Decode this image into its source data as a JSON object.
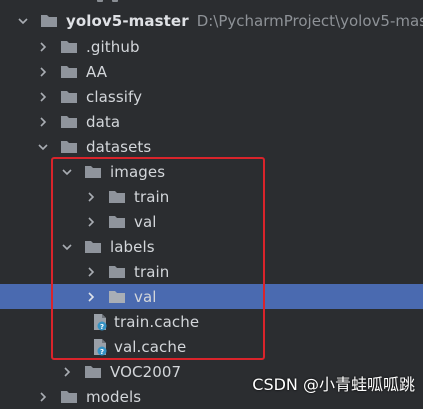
{
  "colors": {
    "background": "#2b2d30",
    "selection": "#4a6ab0",
    "highlight_box": "#d9242b",
    "folder": "#8f949c",
    "text": "#d3d6da",
    "path": "#8e9297",
    "file_badge": "#3592c4"
  },
  "tree": {
    "root": {
      "label": "yolov5-master",
      "path": "D:\\PycharmProject\\yolov5-master",
      "expanded": true
    },
    "items": [
      {
        "label": ".github",
        "type": "folder",
        "expanded": false
      },
      {
        "label": "AA",
        "type": "folder",
        "expanded": false
      },
      {
        "label": "classify",
        "type": "folder",
        "expanded": false
      },
      {
        "label": "data",
        "type": "folder",
        "expanded": false
      },
      {
        "label": "datasets",
        "type": "folder",
        "expanded": true
      },
      {
        "label": "images",
        "type": "folder",
        "expanded": true
      },
      {
        "label": "train",
        "type": "folder",
        "expanded": false
      },
      {
        "label": "val",
        "type": "folder",
        "expanded": false
      },
      {
        "label": "labels",
        "type": "folder",
        "expanded": true
      },
      {
        "label": "train",
        "type": "folder",
        "expanded": false
      },
      {
        "label": "val",
        "type": "folder",
        "expanded": false,
        "selected": true
      },
      {
        "label": "train.cache",
        "type": "file"
      },
      {
        "label": "val.cache",
        "type": "file"
      },
      {
        "label": "VOC2007",
        "type": "folder",
        "expanded": false
      },
      {
        "label": "models",
        "type": "folder",
        "expanded": false
      }
    ]
  },
  "watermark": "CSDN @小青蛙呱呱跳"
}
